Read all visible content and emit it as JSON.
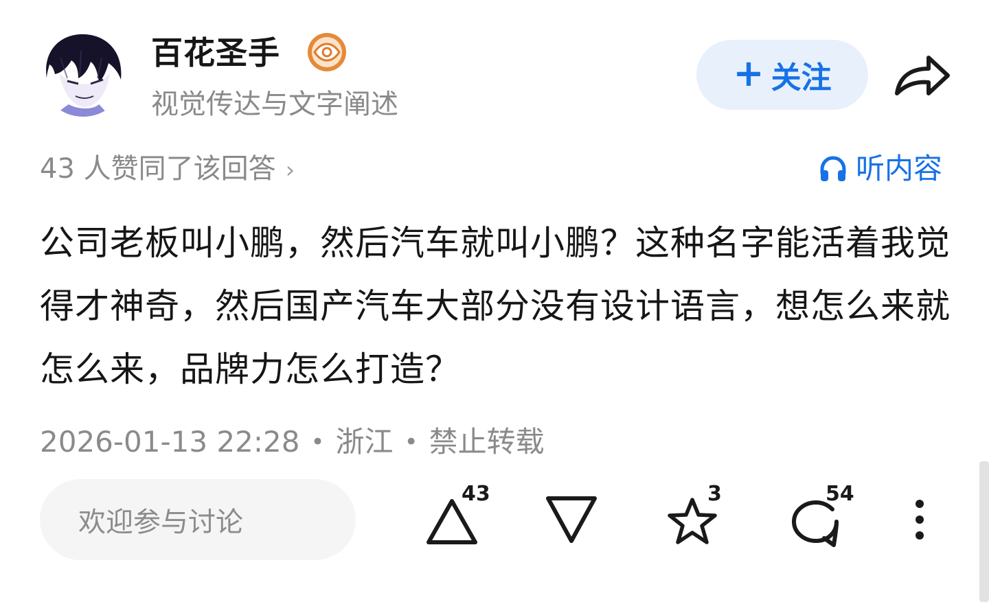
{
  "author": {
    "name": "百花圣手",
    "bio": "视觉传达与文字阐述",
    "badge_icon": "eye-badge-icon"
  },
  "header": {
    "follow_label": "关注",
    "follow_plus": "+",
    "share_icon": "share-arrow-icon"
  },
  "meta": {
    "upvote_summary": "43 人赞同了该回答",
    "upvote_chevron": "›",
    "listen_label": "听内容",
    "listen_icon": "headphones-icon"
  },
  "answer": {
    "text": "公司老板叫小鹏，然后汽车就叫小鹏？这种名字能活着我觉得才神奇，然后国产汽车大部分没有设计语言，想怎么来就怎么来，品牌力怎么打造？"
  },
  "post_meta": {
    "datetime": "2026-01-13 22:28",
    "separator": "•",
    "location": "浙江",
    "repost_policy": "禁止转载"
  },
  "action_bar": {
    "comment_placeholder": "欢迎参与讨论",
    "upvote_count": "43",
    "favorite_count": "3",
    "comment_count": "54"
  },
  "colors": {
    "accent": "#1772e6",
    "follow_bg": "#e8f1fb",
    "muted_text": "#8a8a8a",
    "input_bg": "#f5f5f6"
  }
}
